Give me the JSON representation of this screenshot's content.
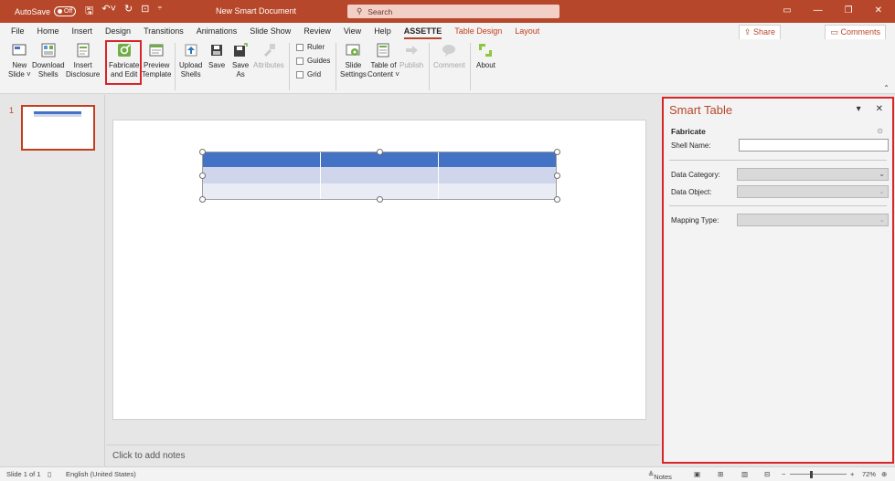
{
  "titlebar": {
    "autosave_label": "AutoSave",
    "autosave_state": "Off",
    "doc_title": "New Smart Document",
    "search_placeholder": "Search",
    "search_icon": "search-icon"
  },
  "tabs": [
    {
      "label": "File"
    },
    {
      "label": "Home"
    },
    {
      "label": "Insert"
    },
    {
      "label": "Design"
    },
    {
      "label": "Transitions"
    },
    {
      "label": "Animations"
    },
    {
      "label": "Slide Show"
    },
    {
      "label": "Review"
    },
    {
      "label": "View"
    },
    {
      "label": "Help"
    },
    {
      "label": "ASSETTE"
    },
    {
      "label": "Table Design"
    },
    {
      "label": "Layout"
    }
  ],
  "share_label": "Share",
  "comments_label": "Comments",
  "ribbon": {
    "new_slide": [
      "New",
      "Slide ˅"
    ],
    "download_shells": [
      "Download",
      "Shells"
    ],
    "insert_disclosure": [
      "Insert",
      "Disclosure"
    ],
    "fabricate": [
      "Fabricate",
      "and Edit"
    ],
    "preview_template": [
      "Preview",
      "Template"
    ],
    "upload_shells": [
      "Upload",
      "Shells"
    ],
    "save": [
      "Save",
      ""
    ],
    "save_as": [
      "Save",
      "As"
    ],
    "attributes": [
      "Attributes",
      ""
    ],
    "ruler": "Ruler",
    "guides": "Guides",
    "grid": "Grid",
    "slide_settings": [
      "Slide",
      "Settings"
    ],
    "table_of_content": [
      "Table of",
      "Content ˅"
    ],
    "publish": [
      "Publish",
      ""
    ],
    "comment": [
      "Comment",
      ""
    ],
    "about": [
      "About",
      ""
    ]
  },
  "slides_pane": {
    "slide_number": "1"
  },
  "canvas": {
    "notes_placeholder": "Click to add notes"
  },
  "panel": {
    "title": "Smart Table",
    "section": "Fabricate",
    "shell_name_label": "Shell Name:",
    "shell_name_value": "",
    "data_category_label": "Data Category:",
    "data_object_label": "Data Object:",
    "mapping_type_label": "Mapping Type:"
  },
  "status": {
    "slide_info": "Slide 1 of 1",
    "language": "English (United States)",
    "notes": "Notes",
    "zoom": "72%",
    "zoom_minus": "−",
    "zoom_plus": "+"
  },
  "colors": {
    "accent": "#b7472a",
    "table_header": "#4472c4",
    "highlight": "#d9252a"
  }
}
